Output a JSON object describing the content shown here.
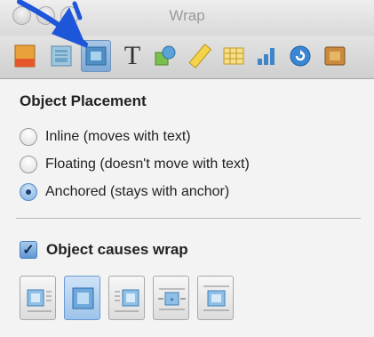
{
  "window": {
    "title": "Wrap"
  },
  "toolbar": {
    "tabs": [
      {
        "name": "tab-document",
        "icon": "document-icon"
      },
      {
        "name": "tab-layout",
        "icon": "layout-icon"
      },
      {
        "name": "tab-wrap",
        "icon": "wrap-icon",
        "selected": true
      },
      {
        "name": "tab-text",
        "icon": "text-icon",
        "glyph": "T"
      },
      {
        "name": "tab-graphic",
        "icon": "graphic-icon"
      },
      {
        "name": "tab-metrics",
        "icon": "ruler-icon"
      },
      {
        "name": "tab-table",
        "icon": "table-icon"
      },
      {
        "name": "tab-chart",
        "icon": "chart-icon"
      },
      {
        "name": "tab-link",
        "icon": "link-icon"
      },
      {
        "name": "tab-quicktime",
        "icon": "quicktime-icon"
      }
    ]
  },
  "placement": {
    "title": "Object Placement",
    "options": [
      {
        "label": "Inline (moves with text)",
        "selected": false
      },
      {
        "label": "Floating (doesn't move with text)",
        "selected": false
      },
      {
        "label": "Anchored (stays with anchor)",
        "selected": true
      }
    ]
  },
  "wrap": {
    "checkbox_label": "Object causes wrap",
    "checked": true,
    "styles": [
      {
        "name": "wrap-left",
        "selected": false
      },
      {
        "name": "wrap-around",
        "selected": true
      },
      {
        "name": "wrap-right",
        "selected": false
      },
      {
        "name": "wrap-largest-side",
        "selected": false
      },
      {
        "name": "wrap-above-below",
        "selected": false
      }
    ]
  },
  "colors": {
    "selection": "#7ea9d6",
    "annotation_arrow": "#1e56d9"
  }
}
